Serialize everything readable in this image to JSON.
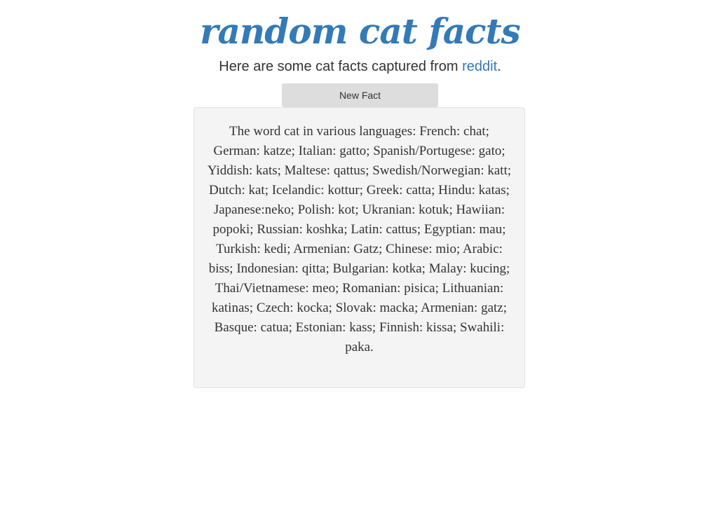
{
  "header": {
    "title": "random cat facts",
    "subtitle_prefix": "Here are some cat facts captured from ",
    "subtitle_link": "reddit",
    "subtitle_suffix": "."
  },
  "controls": {
    "new_fact_label": "New Fact"
  },
  "fact": {
    "text": "The word cat in various languages: French: chat; German: katze; Italian: gatto; Spanish/Portugese: gato; Yiddish: kats; Maltese: qattus; Swedish/Norwegian: katt; Dutch: kat; Icelandic: kottur; Greek: catta; Hindu: katas; Japanese:neko; Polish: kot; Ukranian: kotuk; Hawiian: popoki; Russian: koshka; Latin: cattus; Egyptian: mau; Turkish: kedi; Armenian: Gatz; Chinese: mio; Arabic: biss; Indonesian: qitta; Bulgarian: kotka; Malay: kucing; Thai/Vietnamese: meo; Romanian: pisica; Lithuanian: katinas; Czech: kocka; Slovak: macka; Armenian: gatz; Basque: catua; Estonian: kass; Finnish: kissa; Swahili: paka."
  },
  "colors": {
    "accent": "#337ab7",
    "text": "#333333",
    "card_background": "#f4f4f4",
    "button_background": "#dddddd"
  }
}
